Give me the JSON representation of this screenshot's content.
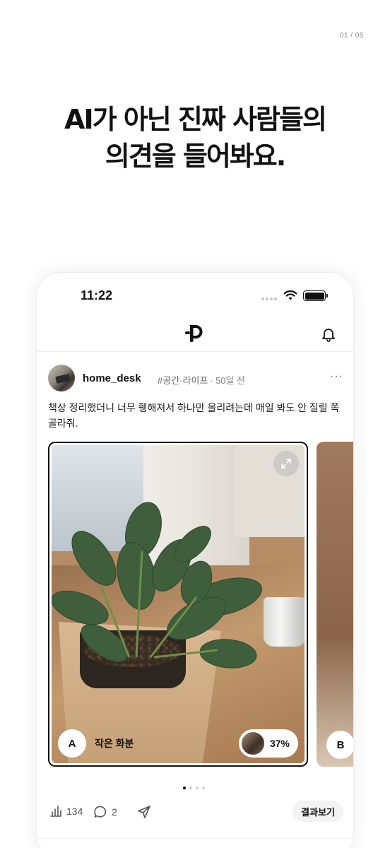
{
  "page_counter": "01 / 05",
  "headline": {
    "line1": "AI가 아닌 진짜 사람들의",
    "line2": "의견을 들어봐요."
  },
  "status_bar": {
    "time": "11:22"
  },
  "post": {
    "username": "home_desk",
    "category": "#공간·라이프",
    "time_ago": "· 50일 전",
    "body": "책상 정리했더니 너무 휑해져서 하나만 올리려는데 매일 봐도 안 질릴 쪽 골라줘.",
    "options": [
      {
        "letter": "A",
        "label": "작은 화분",
        "percent": "37%",
        "percent_value": 37
      },
      {
        "letter": "B"
      }
    ],
    "pagination": {
      "total": 4,
      "active": 1
    },
    "votes": "134",
    "comments": "2",
    "results_button": "결과보기"
  },
  "icons": {
    "app_logo": "p-logo-icon",
    "notifications": "bell-icon",
    "more": "more-horizontal-icon",
    "expand": "expand-icon",
    "votes": "bar-chart-icon",
    "comments": "comment-bubble-icon",
    "share": "send-icon"
  }
}
